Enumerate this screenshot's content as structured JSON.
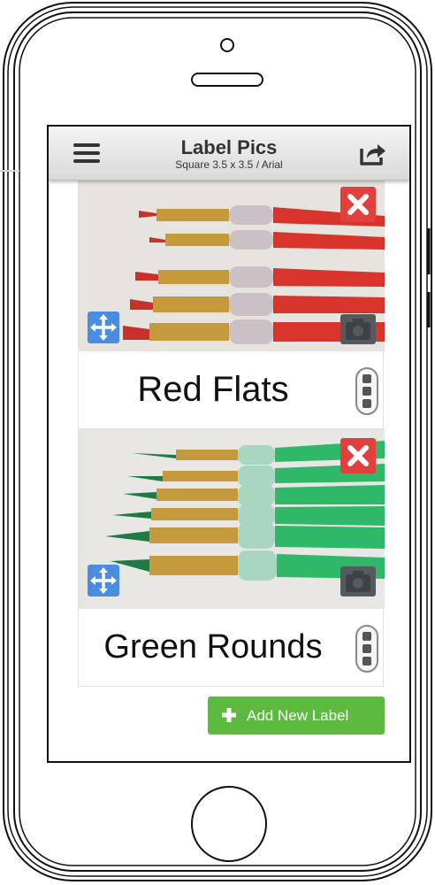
{
  "app": {
    "title": "Label Pics",
    "subtitle": "Square 3.5 x 3.5 / Arial"
  },
  "labels": [
    {
      "name": "Red Flats",
      "photo": "red flat paint brushes"
    },
    {
      "name": "Green Rounds",
      "photo": "green round paint brushes"
    }
  ],
  "actions": {
    "add_label": "Add New Label"
  },
  "colors": {
    "delete": "#e1403c",
    "move": "#4a8de0",
    "add": "#5cba3f",
    "camera": "#555a5f"
  },
  "icons": [
    "hamburger-menu-icon",
    "share-icon",
    "close-icon",
    "move-icon",
    "camera-icon",
    "more-vertical-icon",
    "plus-icon"
  ]
}
